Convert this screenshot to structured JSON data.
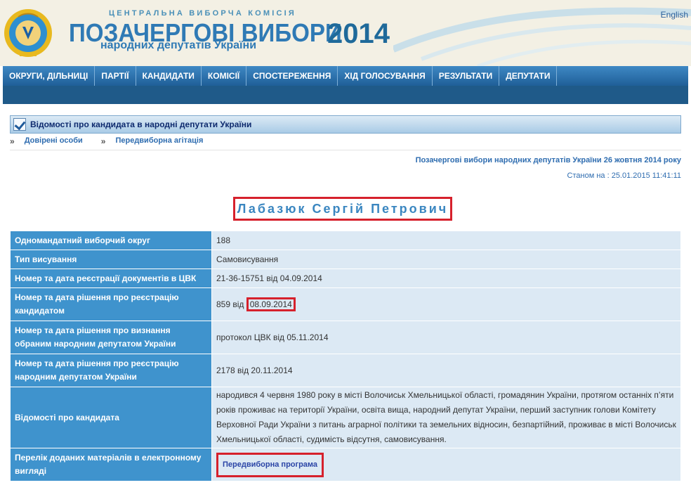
{
  "header": {
    "commission": "ЦЕНТРАЛЬНА ВИБОРЧА КОМІСІЯ",
    "title": "ПОЗАЧЕРГОВІ ВИБОРИ",
    "subtitle": "народних депутатів України",
    "year": "2014",
    "language_link": "English",
    "emblem_icon": "cvk-emblem-icon"
  },
  "nav": {
    "items": [
      "ОКРУГИ, ДІЛЬНИЦІ",
      "ПАРТІЇ",
      "КАНДИДАТИ",
      "КОМІСІЇ",
      "СПОСТЕРЕЖЕННЯ",
      "ХІД ГОЛОСУВАННЯ",
      "РЕЗУЛЬТАТИ",
      "ДЕПУТАТИ"
    ]
  },
  "infobar": {
    "icon": "checkbox-icon",
    "label": "Відомості про кандидата в народні депутати України"
  },
  "links": {
    "arrow": "»",
    "items": [
      "Довірені особи",
      "Передвиборна агітація"
    ]
  },
  "election": {
    "title": "Позачергові вибори народних депутатів України 26 жовтня 2014 року",
    "as_of": "Станом на : 25.01.2015 11:41:11"
  },
  "candidate": {
    "name": "Лабазюк Сергій Петрович"
  },
  "table": {
    "rows": [
      {
        "label": "Одномандатний виборчий округ",
        "value": "188"
      },
      {
        "label": "Тип висування",
        "value": "Самовисування"
      },
      {
        "label": "Номер та дата реєстрації документів в ЦВК",
        "value": "21-36-15751 від 04.09.2014"
      },
      {
        "label": "Номер та дата рішення про реєстрацію кандидатом",
        "value_prefix": "859 від ",
        "value_highlight": "08.09.2014"
      },
      {
        "label": "Номер та дата рішення про визнання обраним народним депутатом України",
        "value": "протокол ЦВК від 05.11.2014"
      },
      {
        "label": "Номер та дата рішення про реєстрацію народним депутатом України",
        "value": "2178 від 20.11.2014"
      },
      {
        "label": "Відомості про кандидата",
        "value": "народився 4 червня 1980 року в місті Волочиськ Хмельницької області, громадянин України, протягом останніх п’яти років проживає на території України, освіта вища, народний депутат України, перший заступник голови Комітету Верховної Ради України з питань аграрної політики та земельних відносин, безпартійний, проживає в місті Волочиськ Хмельницької області, судимість відсутня, самовисування."
      },
      {
        "label": "Перелік доданих матеріалів в електронному вигляді",
        "link": "Передвиборна програма"
      }
    ]
  },
  "colors": {
    "nav_bg": "#2a6fae",
    "label_cell": "#3f93cd",
    "value_cell": "#dce9f4",
    "highlight_border": "#d6212c"
  }
}
